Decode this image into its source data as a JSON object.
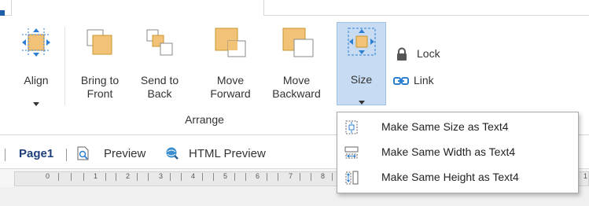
{
  "ribbon": {
    "group_label": "Arrange",
    "buttons": {
      "align": "Align",
      "bring_to_front": "Bring to\nFront",
      "send_to_back": "Send to\nBack",
      "move_forward": "Move\nForward",
      "move_backward": "Move\nBackward",
      "size": "Size"
    },
    "lock": "Lock",
    "link": "Link"
  },
  "size_menu": {
    "items": [
      {
        "label": "Make Same Size as Text4",
        "icon": "same-size-icon"
      },
      {
        "label": "Make Same Width as Text4",
        "icon": "same-width-icon"
      },
      {
        "label": "Make Same Height as Text4",
        "icon": "same-height-icon"
      }
    ]
  },
  "doc_tabs": [
    {
      "label": "Page1",
      "active": true
    },
    {
      "label": "Preview",
      "active": false
    },
    {
      "label": "HTML Preview",
      "active": false
    }
  ],
  "ruler": {
    "ticks": [
      "0",
      "1",
      "2",
      "3",
      "4",
      "5",
      "6",
      "7",
      "8"
    ],
    "trailing_tick": "1"
  },
  "colors": {
    "accent_blue": "#1f5fa8",
    "shape_orange": "#f2c276",
    "selected_bg": "#c7dcf3"
  }
}
